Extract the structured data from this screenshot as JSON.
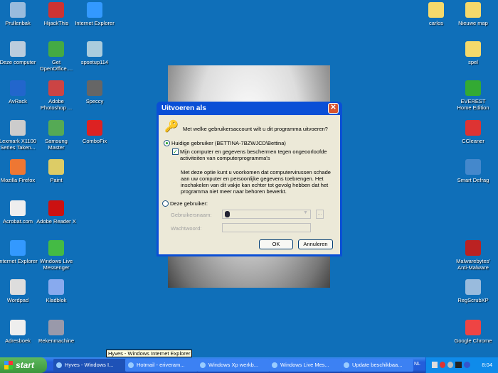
{
  "desktop_icons_left": [
    {
      "label": "Prullenbak",
      "icon": "recycle-bin-icon",
      "color": "#9bd"
    },
    {
      "label": "HijackThis",
      "icon": "hijackthis-icon",
      "color": "#c33"
    },
    {
      "label": "Internet Explorer",
      "icon": "ie-icon",
      "color": "#39f"
    },
    {
      "label": "Deze computer",
      "icon": "computer-icon",
      "color": "#bcd"
    },
    {
      "label": "Get OpenOffice....",
      "icon": "openoffice-icon",
      "color": "#4a4"
    },
    {
      "label": "spsetup114",
      "icon": "setup-icon",
      "color": "#acd"
    },
    {
      "label": "AvRack",
      "icon": "avrack-icon",
      "color": "#26c"
    },
    {
      "label": "Adobe Photoshop ...",
      "icon": "photoshop-icon",
      "color": "#c44"
    },
    {
      "label": "Speccy",
      "icon": "speccy-icon",
      "color": "#666"
    },
    {
      "label": "Lexmark X1100 Series Taken...",
      "icon": "lexmark-icon",
      "color": "#ccc"
    },
    {
      "label": "Samsung Master",
      "icon": "samsung-icon",
      "color": "#5a5"
    },
    {
      "label": "ComboFix",
      "icon": "combofix-icon",
      "color": "#d22"
    },
    {
      "label": "Mozilla Firefox",
      "icon": "firefox-icon",
      "color": "#e73"
    },
    {
      "label": "Paint",
      "icon": "paint-icon",
      "color": "#dc6"
    },
    {
      "label": "Acrobat.com",
      "icon": "acrobat-icon",
      "color": "#eee"
    },
    {
      "label": "Adobe Reader X",
      "icon": "adobe-reader-icon",
      "color": "#c11"
    },
    {
      "label": "Internet Explorer",
      "icon": "ie-icon",
      "color": "#39f"
    },
    {
      "label": "Windows Live Messenger",
      "icon": "messenger-icon",
      "color": "#4b4"
    },
    {
      "label": "Wordpad",
      "icon": "wordpad-icon",
      "color": "#ddd"
    },
    {
      "label": "Kladblok",
      "icon": "notepad-icon",
      "color": "#8ae"
    },
    {
      "label": "Adresboek",
      "icon": "address-book-icon",
      "color": "#eee"
    },
    {
      "label": "Rekenmachine",
      "icon": "calculator-icon",
      "color": "#99a"
    }
  ],
  "desktop_icons_right": [
    {
      "label": "carlos",
      "icon": "folder-icon",
      "color": "#f5d96b"
    },
    {
      "label": "Nieuwe map",
      "icon": "folder-icon",
      "color": "#f5d96b"
    },
    {
      "label": "spel",
      "icon": "folder-icon",
      "color": "#f5d96b"
    },
    {
      "label": "EVEREST Home Edition",
      "icon": "everest-icon",
      "color": "#3a3"
    },
    {
      "label": "CCleaner",
      "icon": "ccleaner-icon",
      "color": "#d33"
    },
    {
      "label": "Smart Defrag",
      "icon": "smart-defrag-icon",
      "color": "#48c"
    },
    {
      "label": "Malwarebytes' Anti-Malware",
      "icon": "malwarebytes-icon",
      "color": "#b22"
    },
    {
      "label": "RegScrubXP",
      "icon": "regscrub-icon",
      "color": "#9bd"
    },
    {
      "label": "Google Chrome",
      "icon": "chrome-icon",
      "color": "#e44"
    }
  ],
  "dialog": {
    "title": "Uitvoeren als",
    "question": "Met welke gebruikersaccount wilt u dit programma uitvoeren?",
    "current_user_label": "Huidige gebruiker (BETTINA-7BZWJCD\\Bettina)",
    "current_user_selected": true,
    "protect_label_1": "Mijn computer en gegevens beschermen tegen ongeoorloofde",
    "protect_label_2": "activiteiten van computerprogramma's",
    "protect_checked": true,
    "info": [
      "Met deze optie kunt u voorkomen dat computervirussen schade",
      "aan uw computer en persoonlijke gegevens toebrengen. Het",
      "inschakelen van dit vakje kan echter tot gevolg hebben dat het",
      "programma niet meer naar behoren bewerkt."
    ],
    "other_user_label": "Deze gebruiker:",
    "username_label": "Gebruikersnaam:",
    "password_label": "Wachtwoord:",
    "browse_label": "...",
    "ok": "OK",
    "cancel": "Annuleren"
  },
  "tooltip": "Hyves - Windows Internet Explorer",
  "taskbar": {
    "start": "start",
    "buttons": [
      {
        "label": "Hyves - Windows I...",
        "icon": "ie-icon",
        "active": true
      },
      {
        "label": "Hotmail - eriveram...",
        "icon": "ie-icon"
      },
      {
        "label": "Windows Xp werkb...",
        "icon": "ie-icon"
      },
      {
        "label": "Windows Live Mes...",
        "icon": "messenger-icon"
      },
      {
        "label": "Update beschikbaa...",
        "icon": "update-icon"
      }
    ],
    "language": "NL",
    "clock": "8:04"
  }
}
